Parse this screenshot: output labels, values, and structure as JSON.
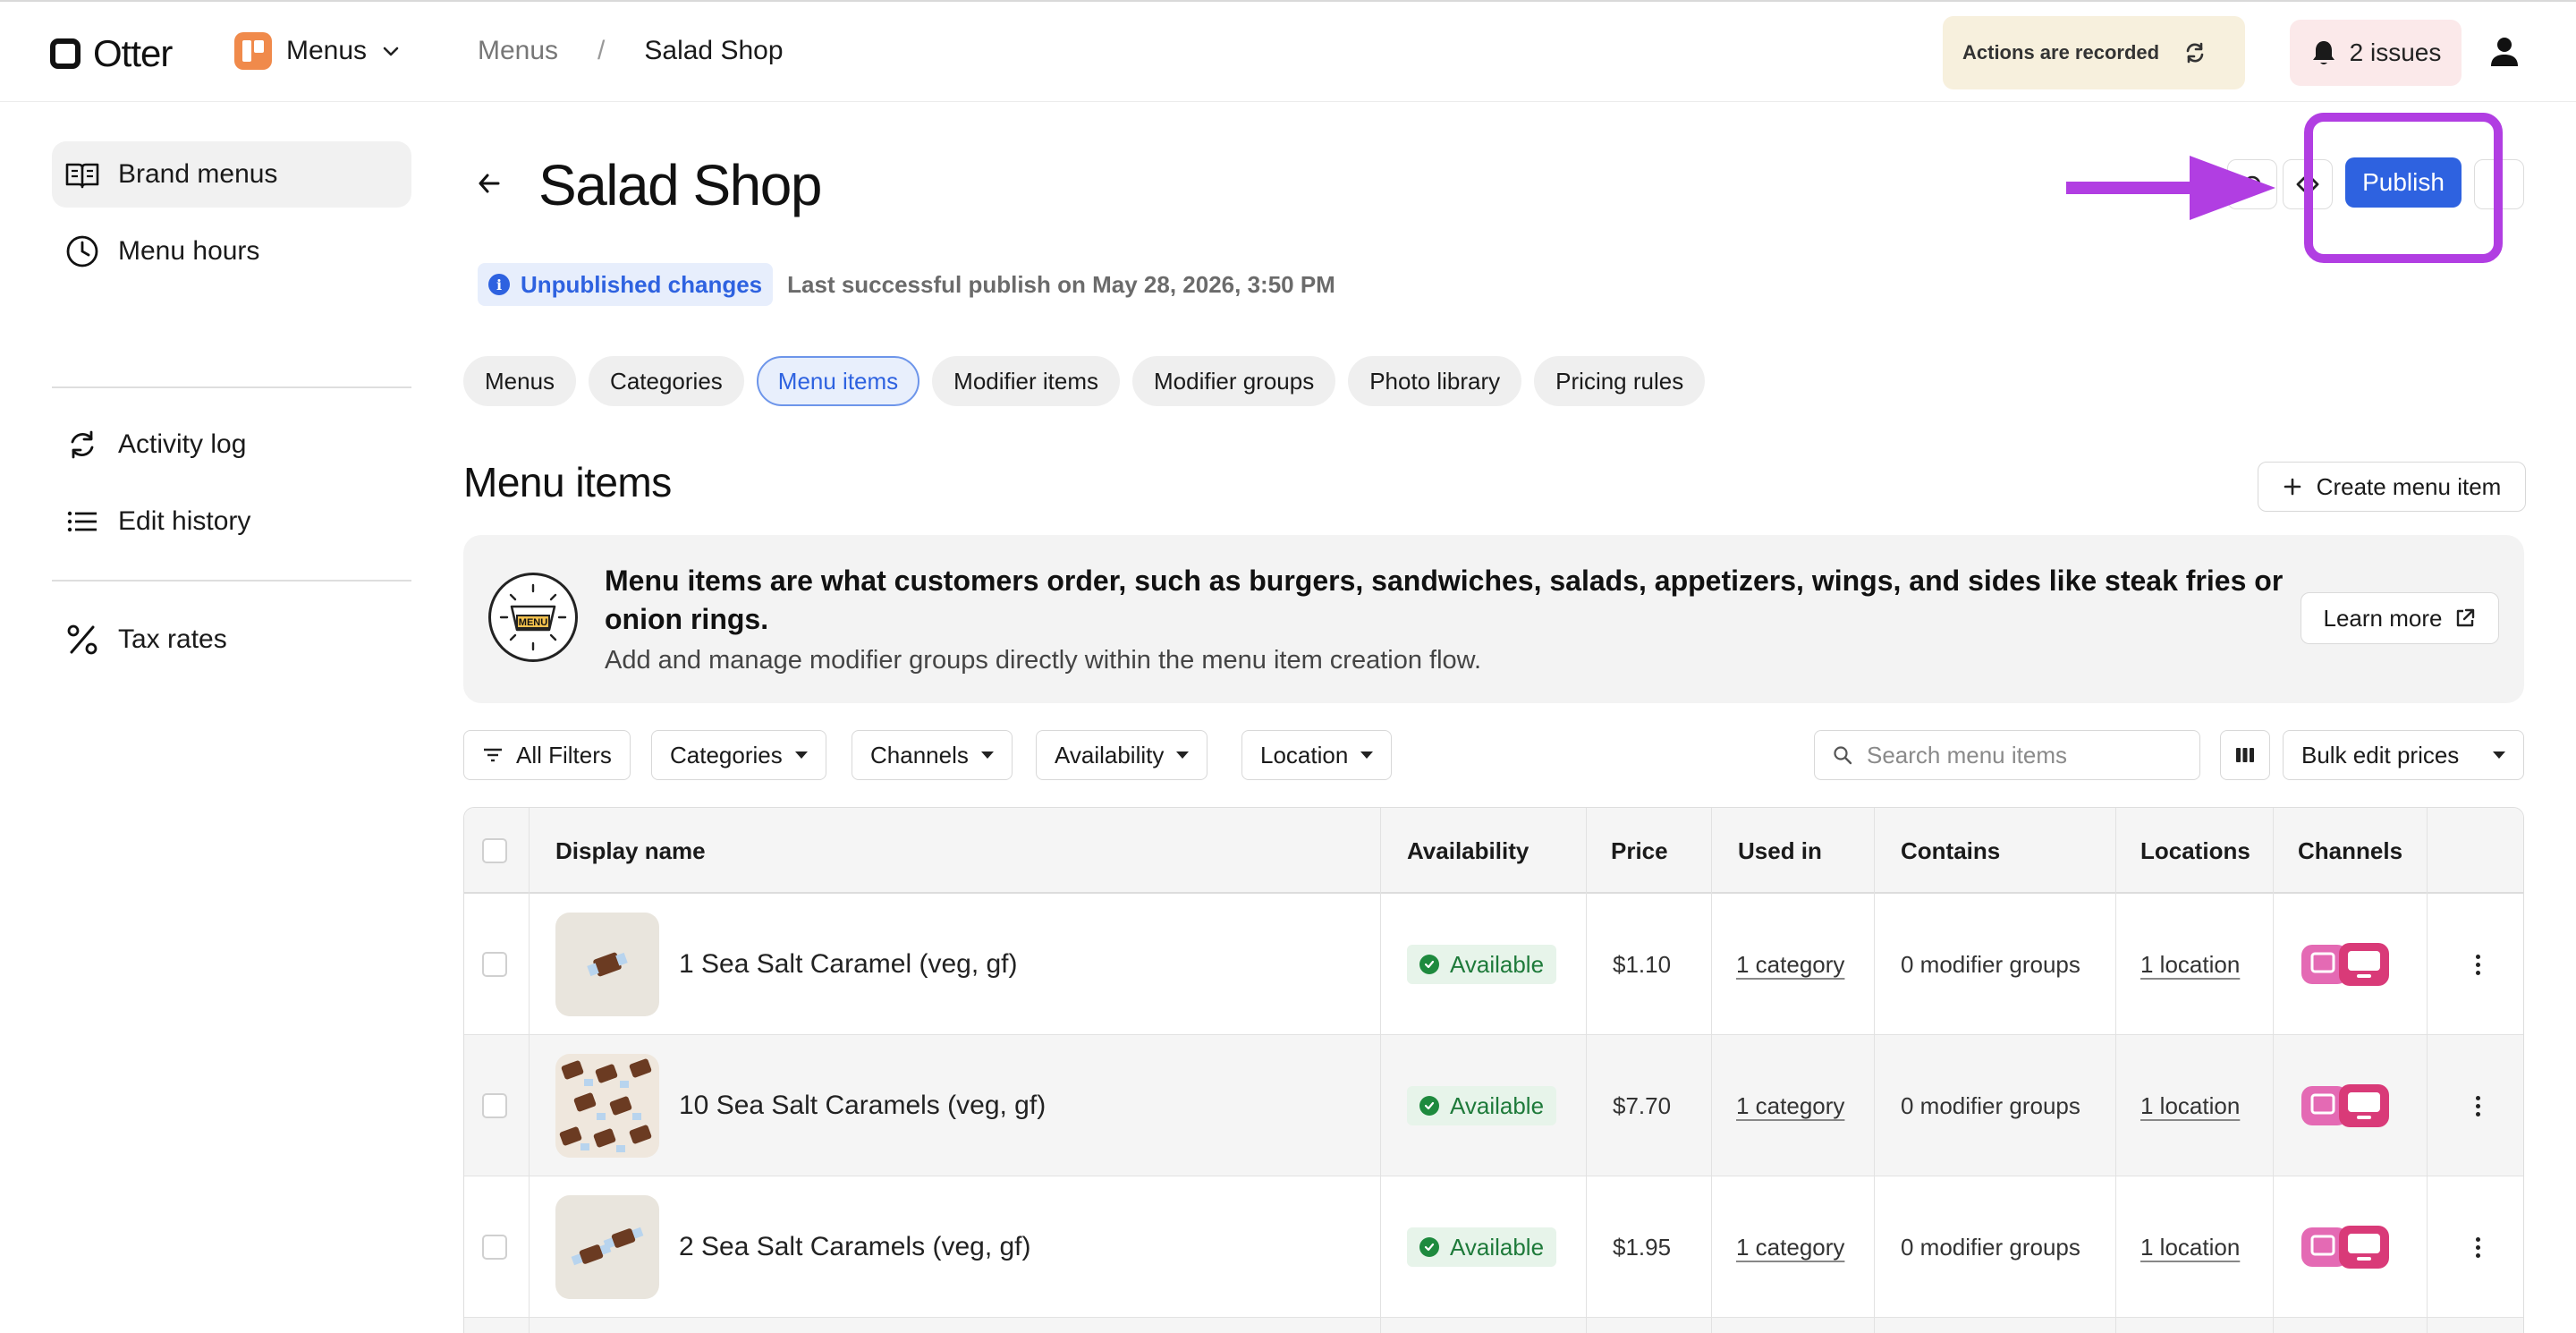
{
  "topbar": {
    "logo_text": "Otter",
    "app_name": "Menus",
    "breadcrumb": [
      "Menus",
      "Salad Shop"
    ],
    "breadcrumb_separator": "/",
    "recorded_label": "Actions are recorded",
    "issues_label": "2 issues"
  },
  "sidebar": {
    "items": [
      {
        "label": "Brand menus",
        "icon": "book-open-icon",
        "active": true
      },
      {
        "label": "Menu hours",
        "icon": "clock-icon"
      },
      {
        "label": "Activity log",
        "icon": "refresh-icon"
      },
      {
        "label": "Edit history",
        "icon": "list-icon"
      },
      {
        "label": "Tax rates",
        "icon": "percent-icon"
      }
    ]
  },
  "header": {
    "title": "Salad Shop",
    "publish_label": "Publish",
    "unpublished_label": "Unpublished changes",
    "info_glyph": "i",
    "last_publish": "Last successful publish on May 28, 2026, 3:50 PM",
    "highlight_color": "#b13ee2"
  },
  "tabs": [
    {
      "label": "Menus"
    },
    {
      "label": "Categories"
    },
    {
      "label": "Menu items",
      "active": true
    },
    {
      "label": "Modifier items"
    },
    {
      "label": "Modifier groups"
    },
    {
      "label": "Photo library"
    },
    {
      "label": "Pricing rules"
    }
  ],
  "section": {
    "title": "Menu items",
    "create_label": "Create menu item"
  },
  "info_card": {
    "badge_text": "MENU",
    "title": "Menu items are what customers order, such as burgers, sandwiches, salads, appetizers, wings, and sides like steak fries or onion rings.",
    "subtitle": "Add and manage modifier groups directly within the menu item creation flow.",
    "learn_more": "Learn more"
  },
  "filters": {
    "all_filters": "All Filters",
    "categories": "Categories",
    "channels": "Channels",
    "availability": "Availability",
    "location": "Location",
    "search_placeholder": "Search menu items",
    "bulk_edit": "Bulk edit prices"
  },
  "table": {
    "headers": {
      "display_name": "Display name",
      "availability": "Availability",
      "price": "Price",
      "used_in": "Used in",
      "contains": "Contains",
      "locations": "Locations",
      "channels": "Channels"
    },
    "rows": [
      {
        "name": "1 Sea Salt Caramel (veg, gf)",
        "availability": "Available",
        "price": "$1.10",
        "used_in": "1 category",
        "contains": "0 modifier groups",
        "locations": "1 location"
      },
      {
        "name": "10 Sea Salt Caramels (veg, gf)",
        "availability": "Available",
        "price": "$7.70",
        "used_in": "1 category",
        "contains": "0 modifier groups",
        "locations": "1 location"
      },
      {
        "name": "2 Sea Salt Caramels (veg, gf)",
        "availability": "Available",
        "price": "$1.95",
        "used_in": "1 category",
        "contains": "0 modifier groups",
        "locations": "1 location"
      }
    ]
  },
  "colors": {
    "accent": "#2e62e0",
    "highlight": "#b13ee2",
    "available_green": "#1e8a3e",
    "channel_pink": "#e0468d"
  }
}
